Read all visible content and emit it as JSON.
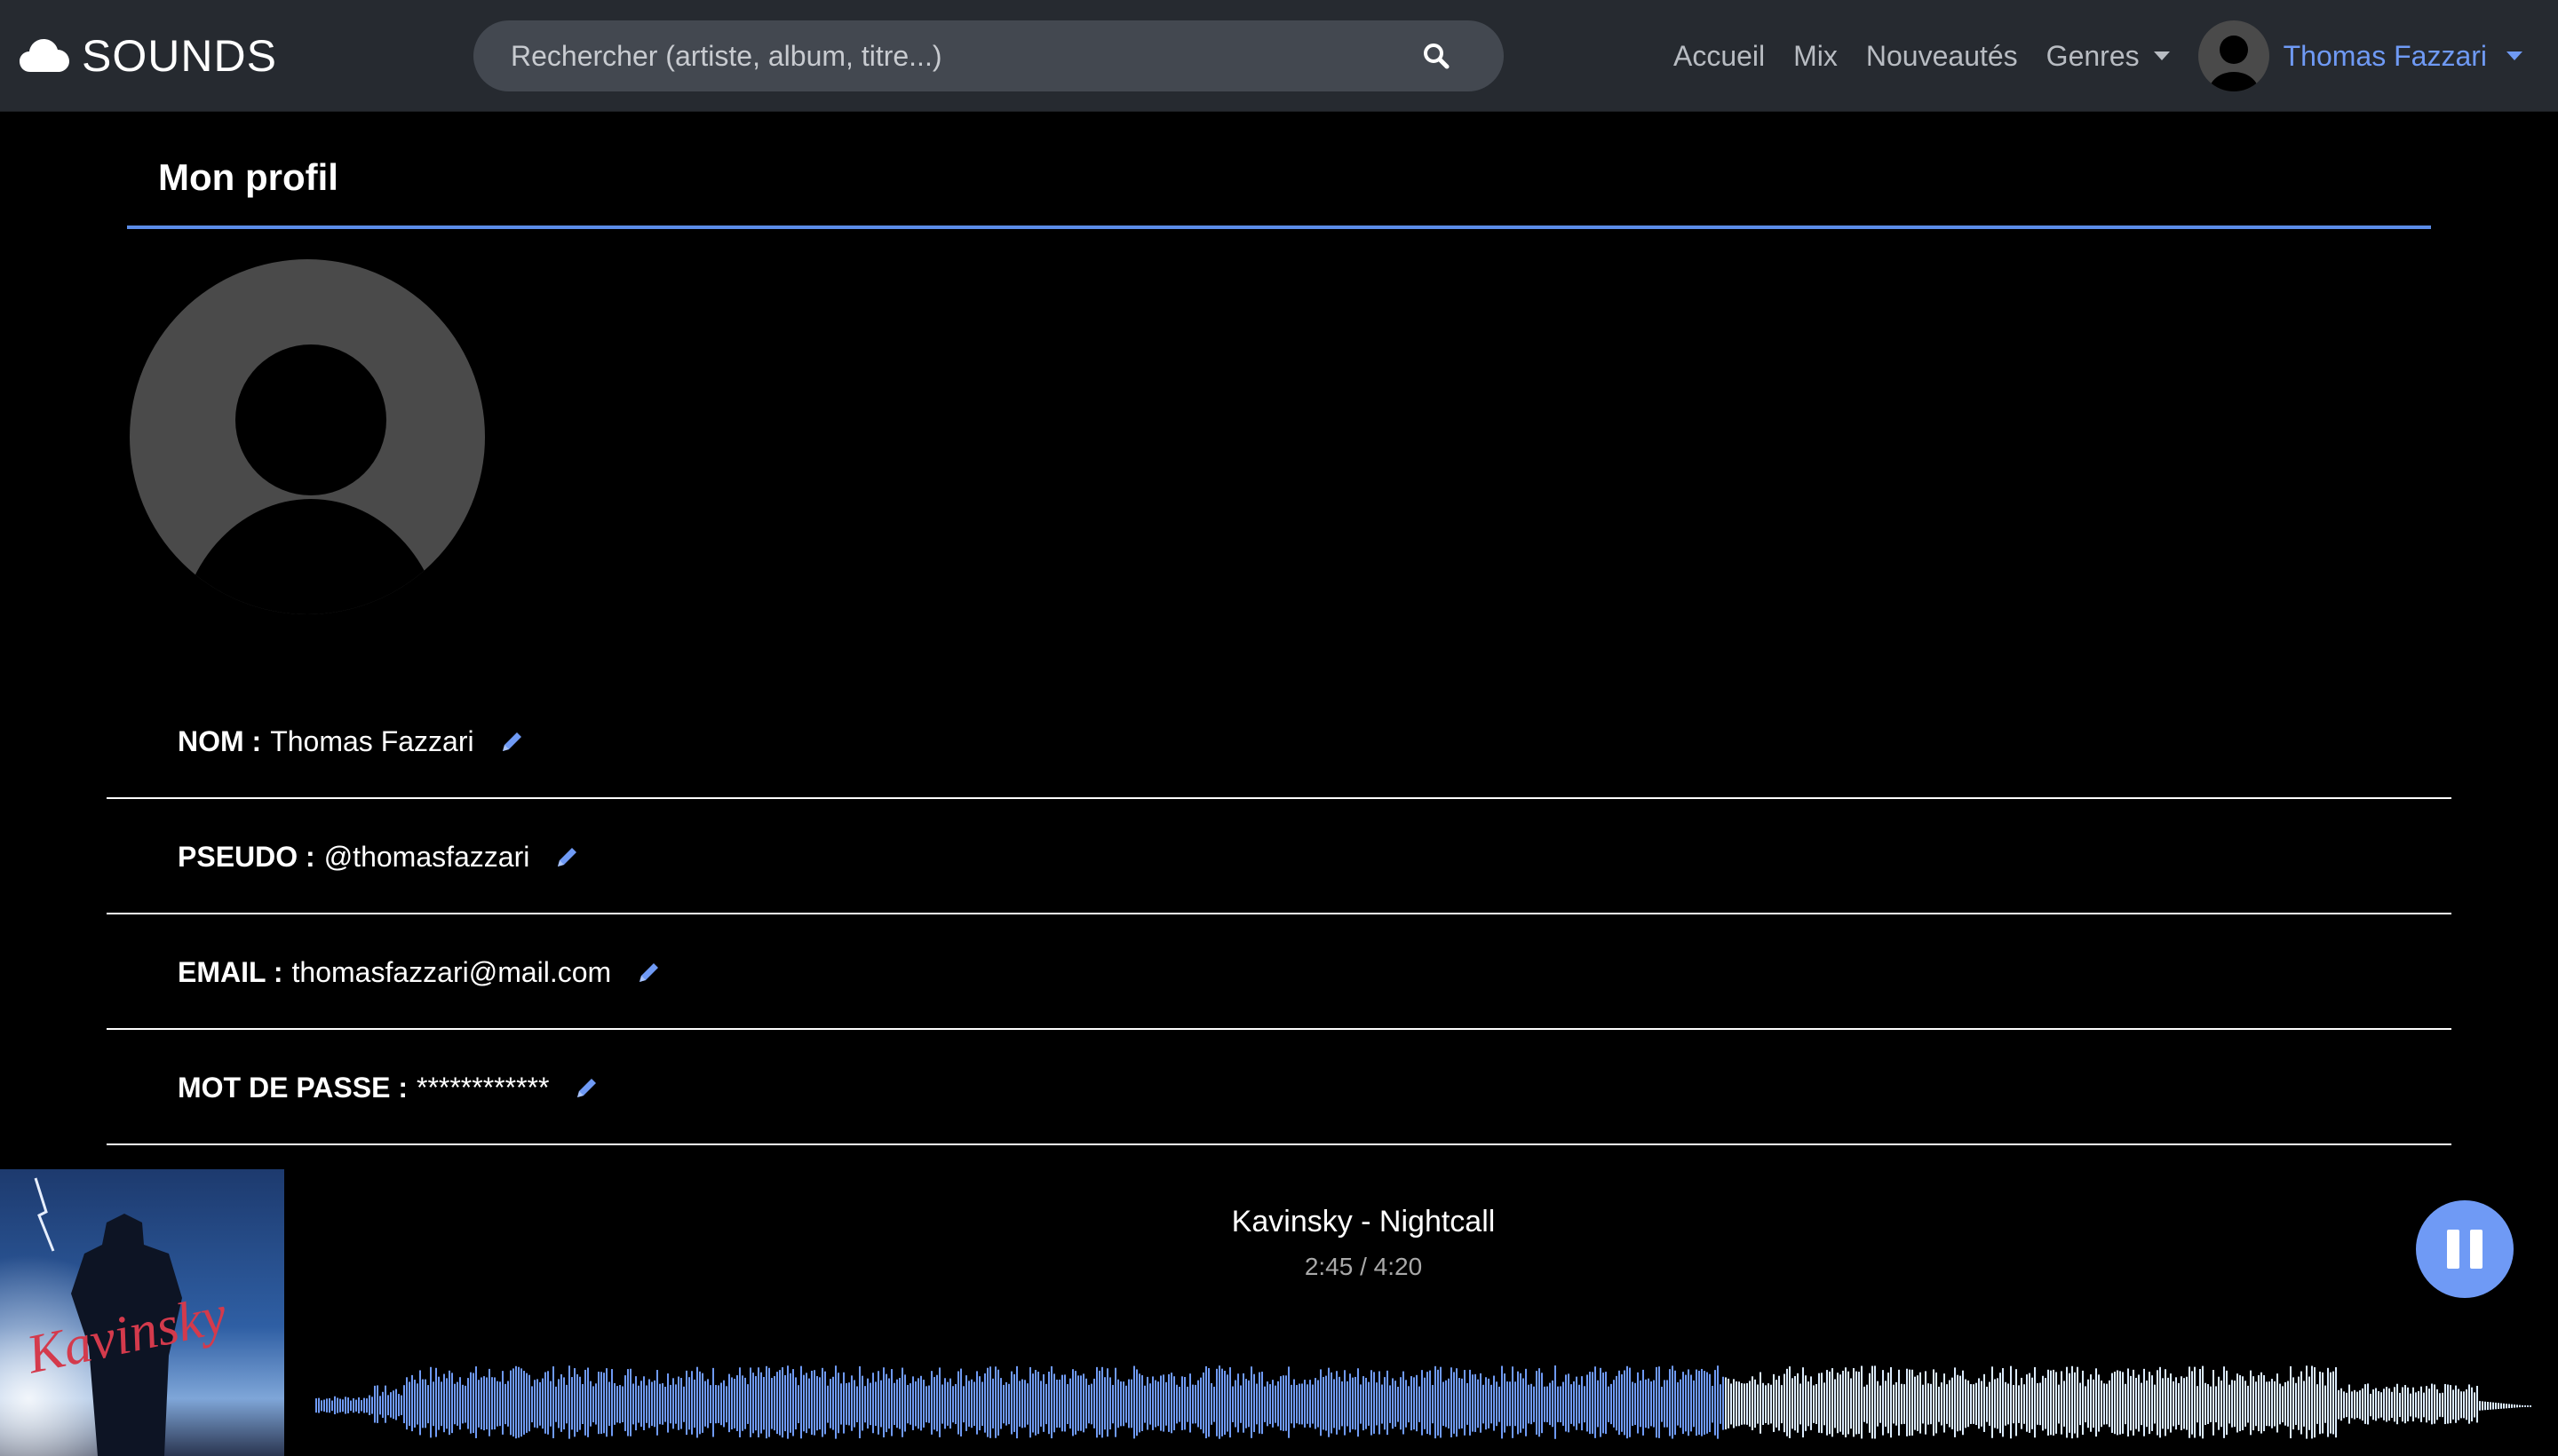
{
  "navbar": {
    "brand": "SOUNDS",
    "search_placeholder": "Rechercher (artiste, album, titre...)",
    "links": {
      "home": "Accueil",
      "mix": "Mix",
      "news": "Nouveautés",
      "genres": "Genres"
    },
    "user_name": "Thomas Fazzari"
  },
  "profile": {
    "heading": "Mon profil",
    "fields": [
      {
        "label": "NOM :",
        "value": "Thomas Fazzari"
      },
      {
        "label": "PSEUDO :",
        "value": "@thomasfazzari"
      },
      {
        "label": "EMAIL :",
        "value": "thomasfazzari@mail.com"
      },
      {
        "label": "MOT DE PASSE :",
        "value": "************"
      }
    ]
  },
  "player": {
    "album_text": "Kavinsky",
    "track": "Kavinsky - Nightcall",
    "time": "2:45 / 4:20",
    "progress": 0.635
  },
  "colors": {
    "accent": "#6f9af5",
    "navbar": "#262a30",
    "wave_played": "#6f9af5",
    "wave_remaining": "#dcecff"
  }
}
